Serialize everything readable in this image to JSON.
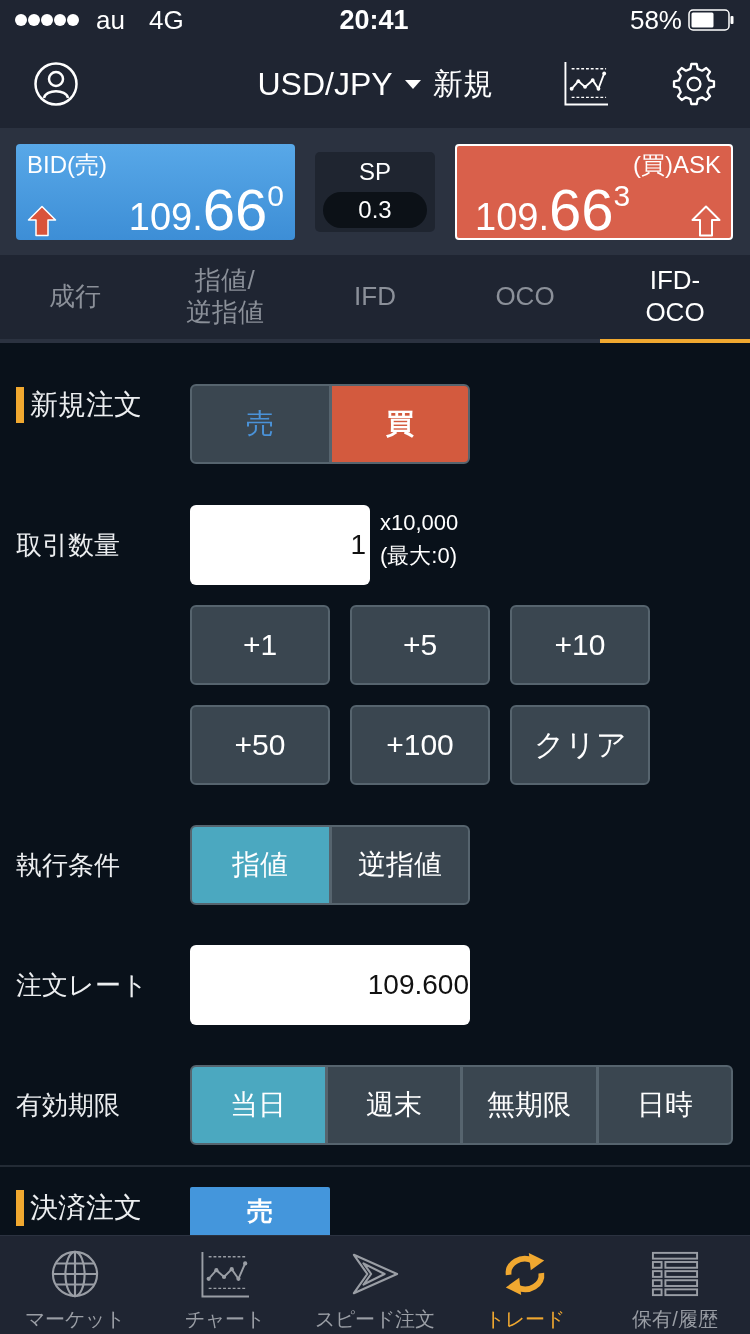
{
  "status_bar": {
    "carrier": "au",
    "network": "4G",
    "time": "20:41",
    "battery": "58%"
  },
  "header": {
    "pair": "USD/JPY",
    "mode": "新規"
  },
  "quotes": {
    "bid": {
      "label": "BID(売)",
      "price_prefix": "109.",
      "price_pips": "66",
      "price_fraction": "0"
    },
    "spread": {
      "label": "SP",
      "value": "0.3"
    },
    "ask": {
      "label": "(買)ASK",
      "price_prefix": "109.",
      "price_pips": "66",
      "price_fraction": "3"
    }
  },
  "order_tabs": [
    {
      "label": "成行",
      "selected": false
    },
    {
      "label": "指値/逆指値",
      "selected": false
    },
    {
      "label": "IFD",
      "selected": false
    },
    {
      "label": "OCO",
      "selected": false
    },
    {
      "label": "IFD-OCO",
      "selected": true
    }
  ],
  "new_order": {
    "title": "新規注文",
    "sides": [
      {
        "label": "売",
        "kind": "sell",
        "selected": false
      },
      {
        "label": "買",
        "kind": "buy",
        "selected": true
      }
    ]
  },
  "quantity": {
    "label": "取引数量",
    "value": "1",
    "unit": "x10,000",
    "max": "(最大:0)",
    "increments": [
      "+1",
      "+5",
      "+10",
      "+50",
      "+100",
      "クリア"
    ]
  },
  "execution": {
    "label": "執行条件",
    "options": [
      {
        "label": "指値",
        "selected": true
      },
      {
        "label": "逆指値",
        "selected": false
      }
    ]
  },
  "rate": {
    "label": "注文レート",
    "value": "109.600"
  },
  "expiry": {
    "label": "有効期限",
    "options": [
      {
        "label": "当日",
        "selected": true
      },
      {
        "label": "週末",
        "selected": false
      },
      {
        "label": "無期限",
        "selected": false
      },
      {
        "label": "日時",
        "selected": false
      }
    ]
  },
  "settlement_order": {
    "title": "決済注文",
    "sides": [
      {
        "label": "売",
        "kind": "sell",
        "selected": true
      }
    ]
  },
  "bottom_nav": [
    {
      "label": "マーケット",
      "selected": false
    },
    {
      "label": "チャート",
      "selected": false
    },
    {
      "label": "スピード注文",
      "selected": false
    },
    {
      "label": "トレード",
      "selected": true
    },
    {
      "label": "保有/履歴",
      "selected": false
    }
  ]
}
